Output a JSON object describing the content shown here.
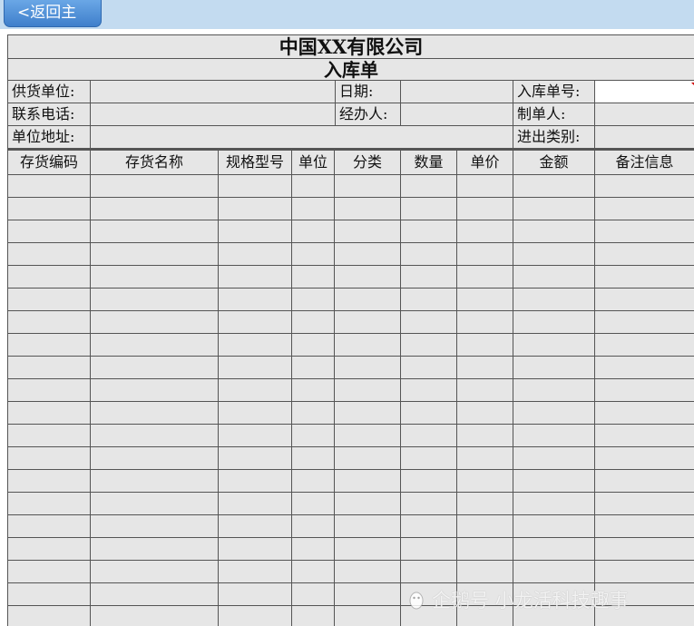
{
  "toolbar": {
    "back_label": "<返回主"
  },
  "form": {
    "company": "中国XX有限公司",
    "doc_title": "入库单",
    "fields": {
      "supplier_label": "供货单位:",
      "date_label": "日期:",
      "order_no_label": "入库单号:",
      "phone_label": "联系电话:",
      "handler_label": "经办人:",
      "maker_label": "制单人:",
      "address_label": "单位地址:",
      "io_type_label": "进出类别:"
    },
    "columns": [
      "存货编码",
      "存货名称",
      "规格型号",
      "单位",
      "分类",
      "数量",
      "单价",
      "金额",
      "备注信息"
    ]
  },
  "watermark": {
    "text": "企鹅号 小龙活科技趣事",
    "icon": "penguin-icon"
  }
}
